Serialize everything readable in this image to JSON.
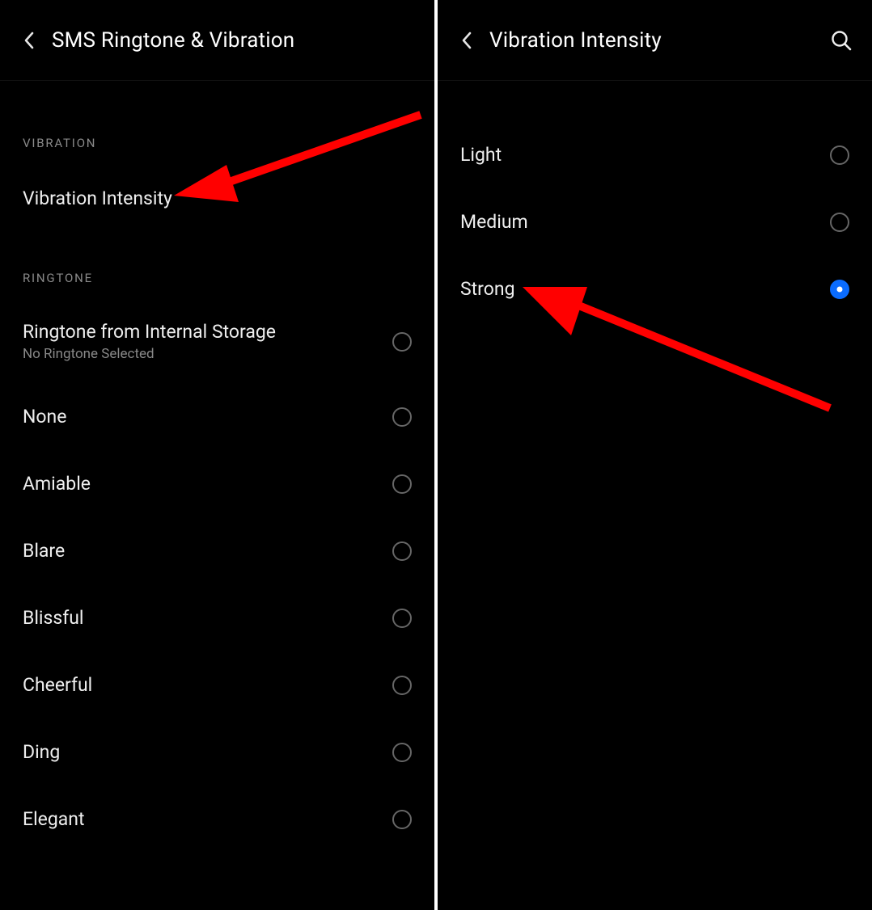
{
  "left": {
    "title": "SMS Ringtone & Vibration",
    "sections": {
      "vibration": {
        "header": "VIBRATION",
        "item": "Vibration Intensity"
      },
      "ringtone": {
        "header": "RINGTONE",
        "storage": {
          "label": "Ringtone from Internal Storage",
          "sub": "No Ringtone Selected"
        },
        "options": [
          "None",
          "Amiable",
          "Blare",
          "Blissful",
          "Cheerful",
          "Ding",
          "Elegant"
        ]
      }
    }
  },
  "right": {
    "title": "Vibration Intensity",
    "options": [
      {
        "label": "Light",
        "selected": false
      },
      {
        "label": "Medium",
        "selected": false
      },
      {
        "label": "Strong",
        "selected": true
      }
    ]
  },
  "colors": {
    "accent": "#0a6cff",
    "annotation": "#ff0000"
  }
}
